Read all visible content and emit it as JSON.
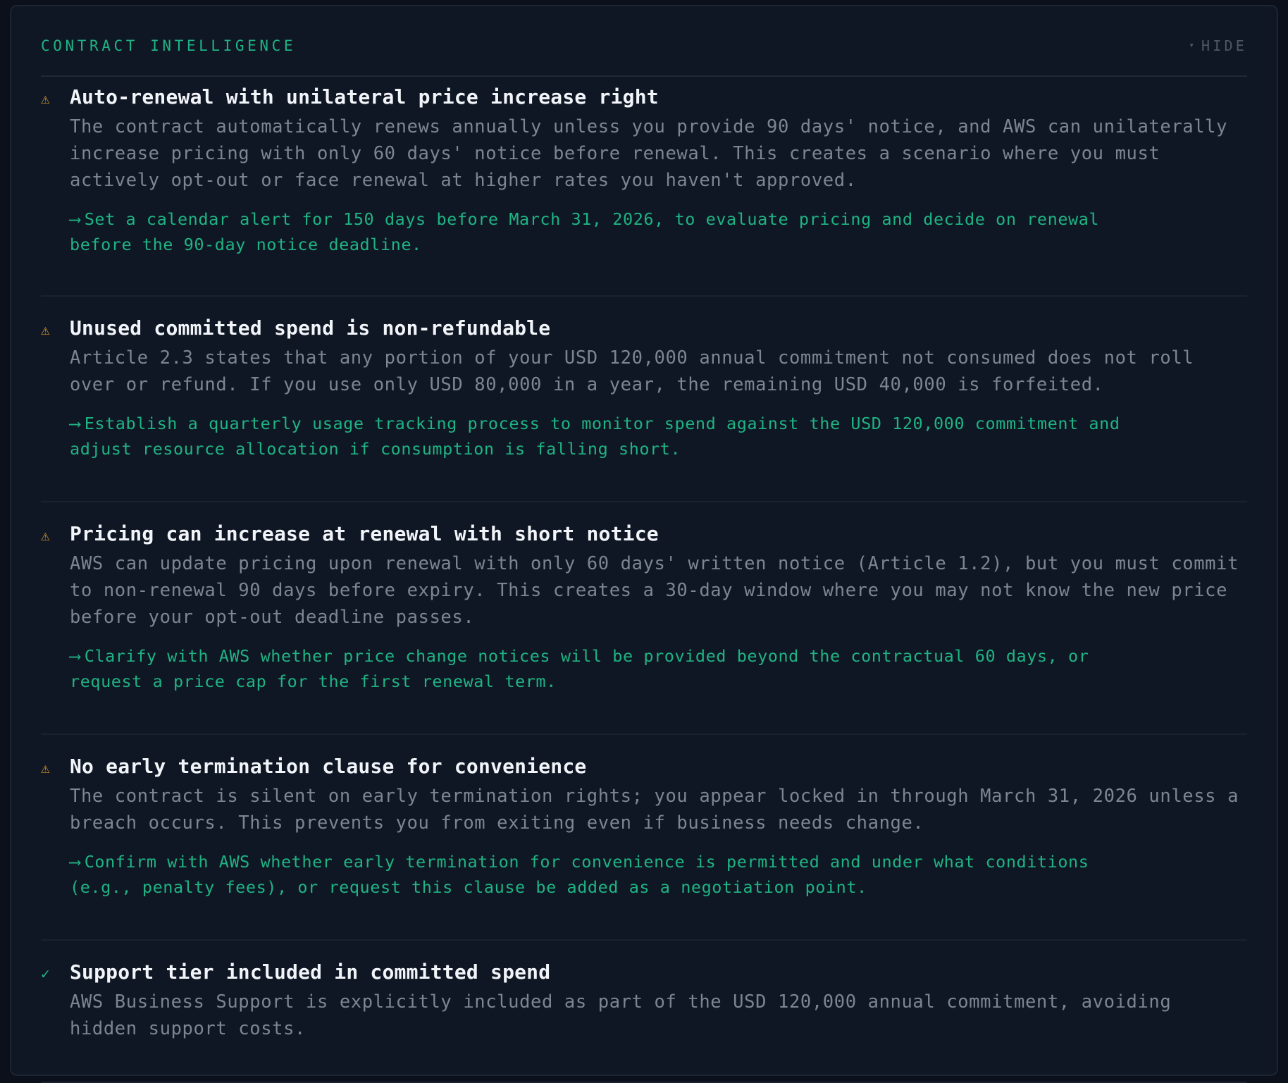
{
  "panel": {
    "title": "CONTRACT INTELLIGENCE",
    "toggle_caret": "▾",
    "toggle_label": "HIDE"
  },
  "colors": {
    "accent": "#1fb383",
    "warning": "#d99a2b",
    "background": "#101724"
  },
  "findings": [
    {
      "icon": "warning-icon",
      "icon_glyph": "⚠",
      "title": "Auto-renewal with unilateral price increase right",
      "body": "The contract automatically renews annually unless you provide 90 days' notice, and AWS can unilaterally increase pricing with only 60 days' notice before renewal. This creates a scenario where you must actively opt-out or face renewal at higher rates you haven't approved.",
      "arrow": "⟶",
      "action": "Set a calendar alert for 150 days before March 31, 2026, to evaluate pricing and decide on renewal before the 90-day notice deadline."
    },
    {
      "icon": "warning-icon",
      "icon_glyph": "⚠",
      "title": "Unused committed spend is non-refundable",
      "body": "Article 2.3 states that any portion of your USD 120,000 annual commitment not consumed does not roll over or refund. If you use only USD 80,000 in a year, the remaining USD 40,000 is forfeited.",
      "arrow": "⟶",
      "action": "Establish a quarterly usage tracking process to monitor spend against the USD 120,000 commitment and adjust resource allocation if consumption is falling short."
    },
    {
      "icon": "warning-icon",
      "icon_glyph": "⚠",
      "title": "Pricing can increase at renewal with short notice",
      "body": "AWS can update pricing upon renewal with only 60 days' written notice (Article 1.2), but you must commit to non-renewal 90 days before expiry. This creates a 30-day window where you may not know the new price before your opt-out deadline passes.",
      "arrow": "⟶",
      "action": "Clarify with AWS whether price change notices will be provided beyond the contractual 60 days, or request a price cap for the first renewal term."
    },
    {
      "icon": "warning-icon",
      "icon_glyph": "⚠",
      "title": "No early termination clause for convenience",
      "body": "The contract is silent on early termination rights; you appear locked in through March 31, 2026 unless a breach occurs. This prevents you from exiting even if business needs change.",
      "arrow": "⟶",
      "action": "Confirm with AWS whether early termination for convenience is permitted and under what conditions (e.g., penalty fees), or request this clause be added as a negotiation point."
    },
    {
      "icon": "check-icon",
      "icon_glyph": "✓",
      "title": "Support tier included in committed spend",
      "body": "AWS Business Support is explicitly included as part of the USD 120,000 annual commitment, avoiding hidden support costs.",
      "arrow": "",
      "action": ""
    }
  ]
}
